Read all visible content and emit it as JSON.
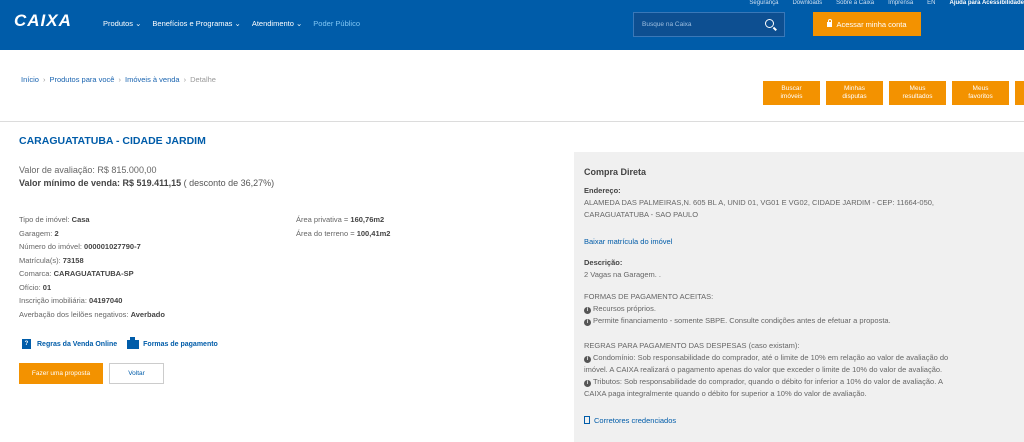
{
  "header": {
    "logo": "CAIXA",
    "top_links": [
      "Segurança",
      "Downloads",
      "Sobre a Caixa",
      "Imprensa",
      "EN",
      "Ajuda para Acessibilidade"
    ],
    "nav": [
      "Produtos ⌄",
      "Benefícios e Programas ⌄",
      "Atendimento ⌄",
      "Poder Público"
    ],
    "search_placeholder": "Busque na Caixa",
    "login_label": "Acessar minha conta"
  },
  "breadcrumb": {
    "items": [
      "Início",
      "Produtos para você",
      "Imóveis à venda"
    ],
    "current": "Detalhe"
  },
  "actions": [
    {
      "l1": "Buscar",
      "l2": "imóveis"
    },
    {
      "l1": "Minhas",
      "l2": "disputas"
    },
    {
      "l1": "Meus",
      "l2": "resultados"
    },
    {
      "l1": "Meus",
      "l2": "favoritos"
    }
  ],
  "property": {
    "title": "CARAGUATATUBA - CIDADE JARDIM",
    "valor_avaliacao_label": "Valor de avaliação:",
    "valor_avaliacao": "R$ 815.000,00",
    "valor_minimo_label": "Valor mínimo de venda:",
    "valor_minimo": "R$ 519.411,15",
    "desconto": "( desconto de 36,27%)",
    "details": [
      {
        "label": "Tipo de imóvel:",
        "value": "Casa"
      },
      {
        "label": "Garagem:",
        "value": "2"
      },
      {
        "label": "Número do imóvel:",
        "value": "000001027790-7"
      },
      {
        "label": "Matrícula(s):",
        "value": "73158"
      },
      {
        "label": "Comarca:",
        "value": "CARAGUATATUBA-SP"
      },
      {
        "label": "Ofício:",
        "value": "01"
      },
      {
        "label": "Inscrição imobiliária:",
        "value": "04197040"
      },
      {
        "label": "Averbação dos leilões negativos:",
        "value": "Averbado"
      }
    ],
    "details_right": [
      {
        "label": "Área privativa =",
        "value": "160,76m2"
      },
      {
        "label": "Área do terreno =",
        "value": "100,41m2"
      }
    ],
    "link_regras": "Regras da Venda Online",
    "link_formas": "Formas de pagamento",
    "btn_proposta": "Fazer uma proposta",
    "btn_voltar": "Voltar"
  },
  "panel": {
    "title": "Compra Direta",
    "endereco_label": "Endereço:",
    "endereco_1": "ALAMEDA DAS PALMEIRAS,N. 605 BL A, UNID 01, VG01 E VG02, CIDADE JARDIM - CEP: 11664-050,",
    "endereco_2": "CARAGUATATUBA - SAO PAULO",
    "matricula_link": "Baixar matrícula do imóvel",
    "descricao_label": "Descrição:",
    "descricao": "2 Vagas na Garagem. .",
    "formas_title": "FORMAS DE PAGAMENTO ACEITAS:",
    "formas": [
      "Recursos próprios.",
      "Permite financiamento - somente SBPE. Consulte condições antes de efetuar a proposta."
    ],
    "regras_title": "REGRAS PARA PAGAMENTO DAS DESPESAS (caso existam):",
    "condominio": "Condomínio: Sob responsabilidade do comprador, até o limite de 10% em relação ao valor de avaliação do",
    "condominio_2": "imóvel. A CAIXA realizará o pagamento apenas do valor que exceder o limite de 10% do valor de avaliação.",
    "tributos": "Tributos: Sob responsabilidade do comprador, quando o débito for inferior a 10% do valor de avaliação. A",
    "tributos_2": "CAIXA paga integralmente quando o débito for superior a 10% do valor de avaliação.",
    "corretores": "Corretores credenciados"
  }
}
